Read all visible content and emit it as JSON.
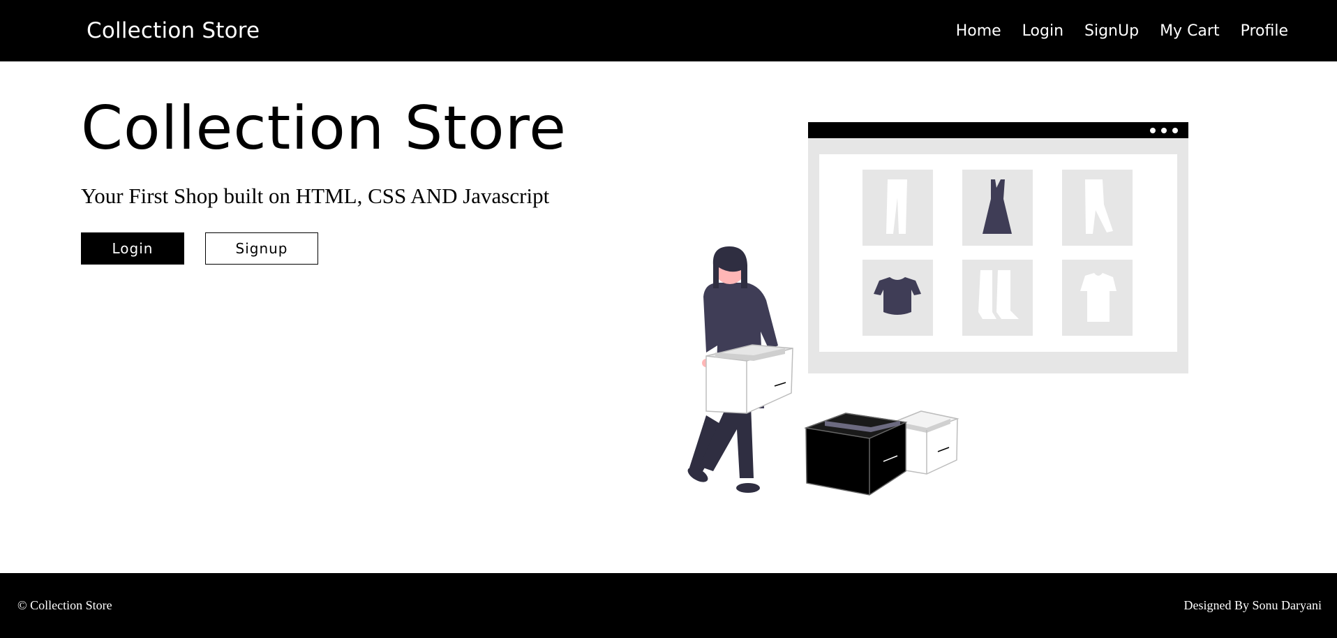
{
  "navbar": {
    "brand": "Collection Store",
    "links": [
      "Home",
      "Login",
      "SignUp",
      "My Cart",
      "Profile"
    ]
  },
  "hero": {
    "title": "Collection Store",
    "subtitle": "Your First Shop built on HTML, CSS AND Javascript",
    "login_label": "Login",
    "signup_label": "Signup"
  },
  "footer": {
    "copyright": "© Collection Store",
    "credit": "Designed By Sonu Daryani"
  },
  "colors": {
    "nav_bg": "#000000",
    "accent": "#3f3d56",
    "skin": "#ffb6b6",
    "light_gray": "#e6e6e6"
  }
}
